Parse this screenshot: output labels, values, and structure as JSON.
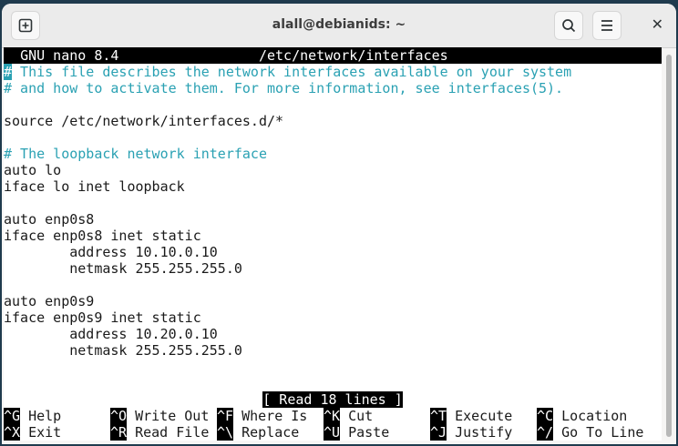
{
  "window": {
    "title": "alall@debianids: ~",
    "new_tab_icon": "plus-square-icon",
    "search_icon": "search-icon",
    "menu_icon": "hamburger-menu-icon",
    "close_icon": "close-icon"
  },
  "nano": {
    "app": "GNU nano 8.4",
    "file": "/etc/network/interfaces",
    "lines": [
      {
        "text": "# This file describes the network interfaces available on your system",
        "comment": true
      },
      {
        "text": "# and how to activate them. For more information, see interfaces(5).",
        "comment": true
      },
      {
        "text": "",
        "comment": false
      },
      {
        "text": "source /etc/network/interfaces.d/*",
        "comment": false
      },
      {
        "text": "",
        "comment": false
      },
      {
        "text": "# The loopback network interface",
        "comment": true
      },
      {
        "text": "auto lo",
        "comment": false
      },
      {
        "text": "iface lo inet loopback",
        "comment": false
      },
      {
        "text": "",
        "comment": false
      },
      {
        "text": "auto enp0s8",
        "comment": false
      },
      {
        "text": "iface enp0s8 inet static",
        "comment": false
      },
      {
        "text": "        address 10.10.0.10",
        "comment": false
      },
      {
        "text": "        netmask 255.255.255.0",
        "comment": false
      },
      {
        "text": "",
        "comment": false
      },
      {
        "text": "auto enp0s9",
        "comment": false
      },
      {
        "text": "iface enp0s9 inet static",
        "comment": false
      },
      {
        "text": "        address 10.20.0.10",
        "comment": false
      },
      {
        "text": "        netmask 255.255.255.0",
        "comment": false
      }
    ],
    "status": "[ Read 18 lines ]",
    "shortcuts": [
      [
        {
          "key": "^G",
          "label": "Help"
        },
        {
          "key": "^O",
          "label": "Write Out"
        },
        {
          "key": "^F",
          "label": "Where Is"
        },
        {
          "key": "^K",
          "label": "Cut"
        },
        {
          "key": "^T",
          "label": "Execute"
        },
        {
          "key": "^C",
          "label": "Location"
        }
      ],
      [
        {
          "key": "^X",
          "label": "Exit"
        },
        {
          "key": "^R",
          "label": "Read File"
        },
        {
          "key": "^\\",
          "label": "Replace"
        },
        {
          "key": "^U",
          "label": "Paste"
        },
        {
          "key": "^J",
          "label": "Justify"
        },
        {
          "key": "^/",
          "label": "Go To Line"
        }
      ]
    ]
  },
  "colors": {
    "comment": "#2aa1b3",
    "background_desktop": "#1f3a4d"
  }
}
